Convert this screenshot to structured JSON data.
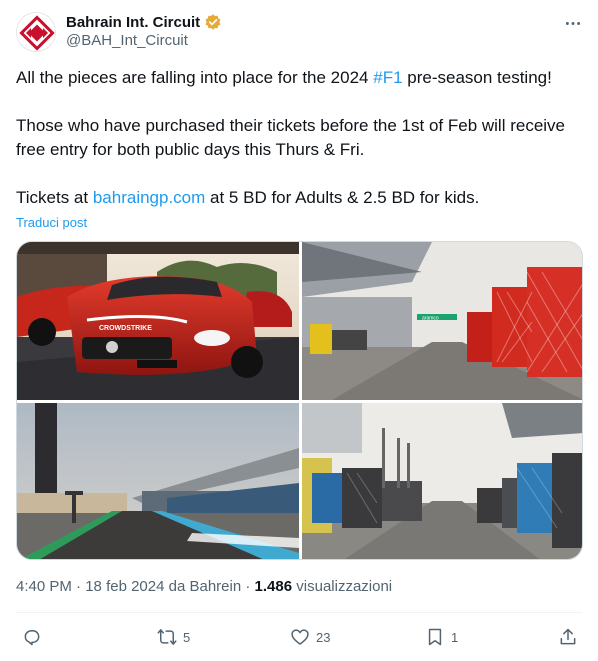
{
  "author": {
    "display_name": "Bahrain Int. Circuit",
    "handle": "@BAH_Int_Circuit",
    "verified_color": "#e8a93b"
  },
  "post": {
    "line1_prefix": "All the pieces are falling into place for the 2024 ",
    "line1_hashtag": "#F1",
    "line1_suffix": " pre-season testing!",
    "para2": "Those who have purchased their tickets before the 1st of Feb will receive free entry for both public days this Thurs & Fri.",
    "para3_prefix": "Tickets at ",
    "para3_link": "bahraingp.com",
    "para3_suffix": " at 5 BD for Adults & 2.5 BD for kids.",
    "translate_label": "Traduci post"
  },
  "media": {
    "images": [
      {
        "name": "safety-car-photo",
        "caption_marks": "CROWDSTRIKE"
      },
      {
        "name": "pitlane-crates-photo",
        "caption_marks": "aramco"
      },
      {
        "name": "main-straight-photo",
        "caption_marks": ""
      },
      {
        "name": "paddock-freight-photo",
        "caption_marks": ""
      }
    ]
  },
  "meta": {
    "time": "4:40 PM",
    "date": "18 feb 2024",
    "location": "da Bahrein",
    "views_count": "1.486",
    "views_label": "visualizzazioni"
  },
  "actions": {
    "reply_count": "",
    "repost_count": "5",
    "like_count": "23",
    "bookmark_count": "1"
  },
  "colors": {
    "link": "#1d9bf0",
    "text": "#0f1419",
    "muted": "#536471"
  }
}
